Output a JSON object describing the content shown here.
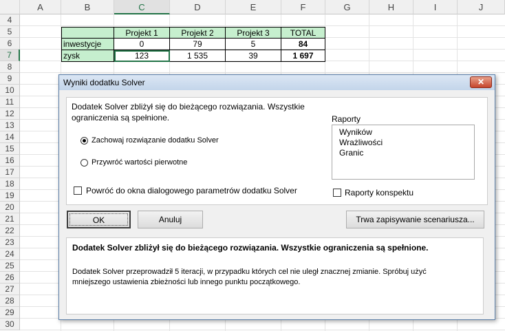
{
  "columns": [
    "A",
    "B",
    "C",
    "D",
    "E",
    "F",
    "G",
    "H",
    "I",
    "J"
  ],
  "rows": [
    "4",
    "5",
    "6",
    "7",
    "8",
    "9",
    "10",
    "11",
    "12",
    "13",
    "14",
    "15",
    "16",
    "17",
    "18",
    "19",
    "20",
    "21",
    "22",
    "23",
    "24",
    "25",
    "26",
    "27",
    "28",
    "29",
    "30"
  ],
  "table": {
    "headers": [
      "Projekt 1",
      "Projekt 2",
      "Projekt 3",
      "TOTAL"
    ],
    "row_labels": [
      "inwestycje",
      "zysk"
    ],
    "values": [
      [
        "0",
        "79",
        "5",
        "84"
      ],
      [
        "123",
        "1 535",
        "39",
        "1 697"
      ]
    ]
  },
  "dialog": {
    "title": "Wyniki dodatku Solver",
    "close": "✕",
    "message_line1": "Dodatek Solver zbliżył się do bieżącego rozwiązania. Wszystkie",
    "message_line2": "ograniczenia są spełnione.",
    "radio_keep": "Zachowaj rozwiązanie dodatku Solver",
    "radio_restore": "Przywróć wartości pierwotne",
    "checkbox_return": "Powróć do okna dialogowego parametrów dodatku Solver",
    "reports_label": "Raporty",
    "reports": [
      "Wyników",
      "Wrażliwości",
      "Granic"
    ],
    "checkbox_outline": "Raporty konspektu",
    "ok": "OK",
    "cancel": "Anuluj",
    "save_scenario": "Trwa zapisywanie scenariusza...",
    "result_bold": "Dodatek Solver zbliżył się do bieżącego rozwiązania. Wszystkie ograniczenia są spełnione.",
    "result_detail1": "Dodatek Solver przeprowadził 5 iteracji, w przypadku których cel nie uległ znacznej zmianie. Spróbuj użyć",
    "result_detail2": "mniejszego ustawienia zbieżności lub innego punktu początkowego."
  }
}
